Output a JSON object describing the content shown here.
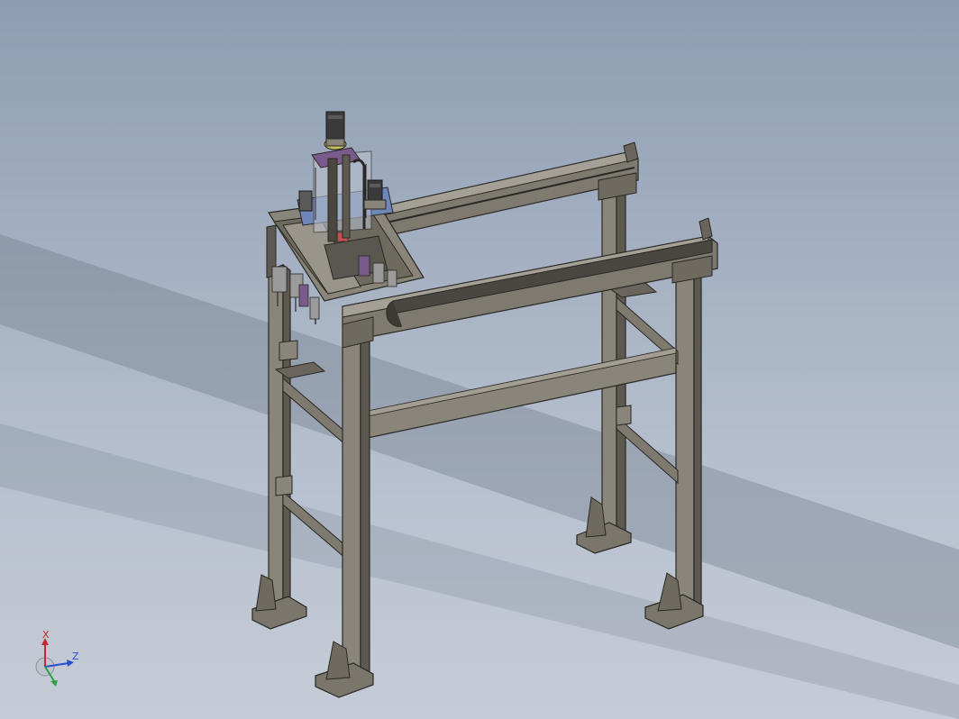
{
  "viewport": {
    "background_top": "#8e9db2",
    "background_bottom": "#c6ccd7"
  },
  "model": {
    "frame_color": "#6f6a60",
    "frame_edge_color": "#2a2824",
    "motor_color": "#3a3a3a",
    "plate_blue": "#6f86b8",
    "plate_purple": "#7a5a8a",
    "accent_yellow": "#c9c15a"
  },
  "triad": {
    "x_label": "X",
    "z_label": "Z",
    "x_color": "#c4282c",
    "y_color": "#2ea043",
    "z_color": "#2a4fd0"
  }
}
